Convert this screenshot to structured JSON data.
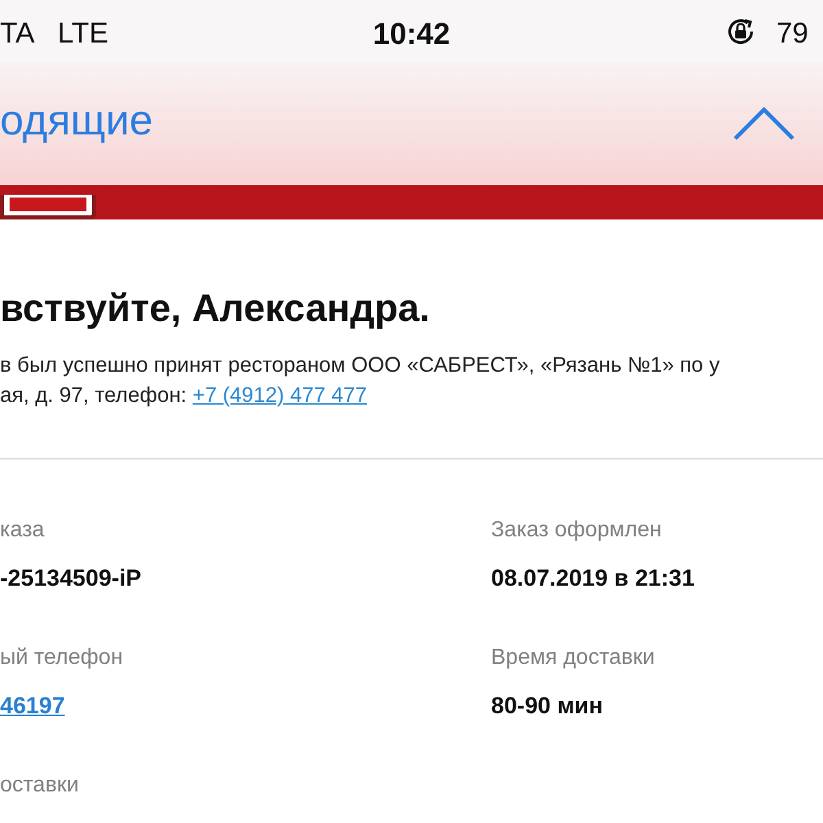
{
  "status_bar": {
    "carrier": "TA",
    "network": "LTE",
    "time": "10:42",
    "battery": "79"
  },
  "nav_bar": {
    "back_label": "одящие"
  },
  "email": {
    "greeting": "вствуйте, Александра.",
    "lines": [
      {
        "text": "в был успешно принят рестораном ООО «САБРЕСТ», «Рязань №1» по у"
      },
      {
        "text": "ая, д. 97, телефон: ",
        "link": "+7 (4912) 477 477"
      }
    ],
    "fields": [
      {
        "label": "каза",
        "value": "-25134509-iP",
        "kind": "text"
      },
      {
        "label": "Заказ оформлен",
        "value": "08.07.2019 в 21:31",
        "kind": "text"
      },
      {
        "label": "ый телефон",
        "value": "46197",
        "kind": "link"
      },
      {
        "label": "Время доставки",
        "value": "80-90 мин",
        "kind": "text"
      },
      {
        "label": "оставки"
      }
    ]
  }
}
